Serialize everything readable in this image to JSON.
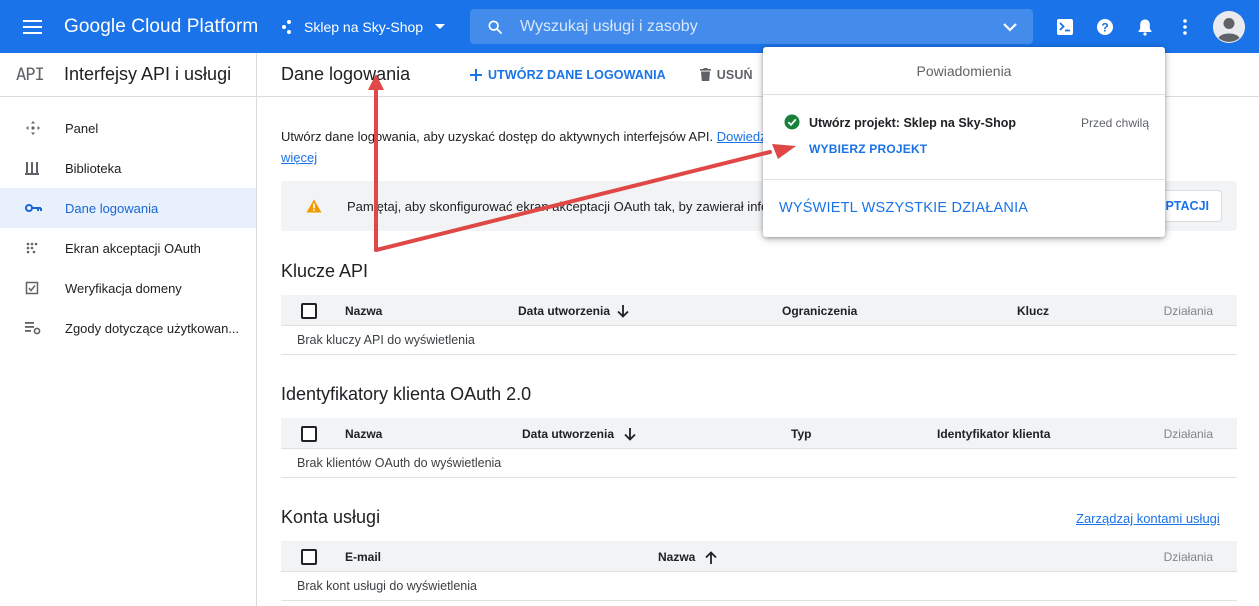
{
  "topbar": {
    "logo": "Google Cloud Platform",
    "project": "Sklep na Sky-Shop",
    "search_placeholder": "Wyszukaj usługi i zasoby"
  },
  "sidebar": {
    "badge": "API",
    "title": "Interfejsy API i usługi",
    "items": [
      {
        "label": "Panel",
        "icon": "dashboard-icon"
      },
      {
        "label": "Biblioteka",
        "icon": "library-icon"
      },
      {
        "label": "Dane logowania",
        "icon": "key-icon",
        "active": true
      },
      {
        "label": "Ekran akceptacji OAuth",
        "icon": "oauth-icon"
      },
      {
        "label": "Weryfikacja domeny",
        "icon": "checkbox-icon"
      },
      {
        "label": "Zgody dotyczące użytkowan...",
        "icon": "settings-list-icon"
      }
    ]
  },
  "main": {
    "title": "Dane logowania",
    "create_label": "UTWÓRZ DANE LOGOWANIA",
    "delete_label": "USUŃ",
    "intro_text": "Utwórz dane logowania, aby uzyskać dostęp do aktywnych interfejsów API.",
    "intro_link_1": "Dowiedz",
    "intro_link_2": "więcej",
    "warning_text": "Pamiętaj, aby skonfigurować ekran akceptacji OAuth tak, by zawierał info",
    "warning_button": "PTACJI"
  },
  "api_keys": {
    "title": "Klucze API",
    "columns": [
      "Nazwa",
      "Data utworzenia",
      "Ograniczenia",
      "Klucz",
      "Działania"
    ],
    "empty": "Brak kluczy API do wyświetlenia"
  },
  "oauth_clients": {
    "title": "Identyfikatory klienta OAuth 2.0",
    "columns": [
      "Nazwa",
      "Data utworzenia",
      "Typ",
      "Identyfikator klienta",
      "Działania"
    ],
    "empty": "Brak klientów OAuth do wyświetlenia"
  },
  "service_accounts": {
    "title": "Konta usługi",
    "manage_link": "Zarządzaj kontami usługi",
    "columns": [
      "E-mail",
      "Nazwa",
      "Działania"
    ],
    "empty": "Brak kont usługi do wyświetlenia"
  },
  "notifications": {
    "title": "Powiadomienia",
    "item_title": "Utwórz projekt: Sklep na Sky-Shop",
    "item_time": "Przed chwilą",
    "item_action": "WYBIERZ PROJEKT",
    "view_all": "WYŚWIETL WSZYSTKIE DZIAŁANIA"
  },
  "colors": {
    "brand": "#1a73e8",
    "success": "#188038",
    "warning": "#f29900",
    "annotation_arrow": "#e04848"
  }
}
